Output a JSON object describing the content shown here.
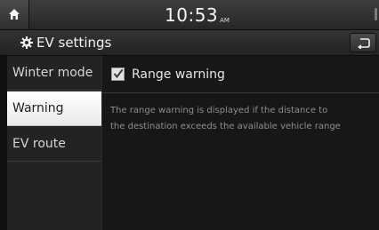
{
  "status_bar": {
    "time": "10:53",
    "ampm": "AM"
  },
  "title_bar": {
    "title": "EV settings"
  },
  "sidebar": {
    "items": [
      {
        "label": "Winter mode"
      },
      {
        "label": "Warning"
      },
      {
        "label": "EV route"
      }
    ],
    "active_index": 1
  },
  "content": {
    "checkbox_label": "Range warning",
    "checkbox_checked": true,
    "description_lines": [
      "The range warning is displayed if the distance to",
      "the destination exceeds the available vehicle range"
    ]
  },
  "colors": {
    "background": "#161616",
    "active_item": "#ffffff",
    "text": "#e6e6e6",
    "secondary_text": "#8e8e8e"
  }
}
